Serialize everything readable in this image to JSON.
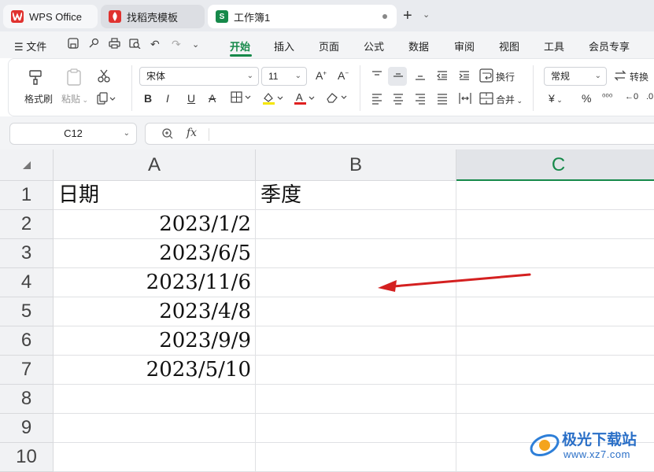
{
  "tabs": {
    "wps": "WPS Office",
    "template": "找稻壳模板",
    "workbook": "工作簿1",
    "workbook_icon": "S"
  },
  "menu": {
    "file": "文件",
    "items": [
      "开始",
      "插入",
      "页面",
      "公式",
      "数据",
      "审阅",
      "视图",
      "工具",
      "会员专享"
    ]
  },
  "ribbon": {
    "format_painter": "格式刷",
    "paste": "粘贴",
    "font_name": "宋体",
    "font_size": "11",
    "wrap": "换行",
    "merge": "合并",
    "number_format": "常规",
    "convert": "转换",
    "currency": "¥",
    "percent": "%"
  },
  "formula_bar": {
    "cell_ref": "C12",
    "fx": "fx"
  },
  "sheet": {
    "columns": [
      "A",
      "B",
      "C"
    ],
    "rows": [
      "1",
      "2",
      "3",
      "4",
      "5",
      "6",
      "7",
      "8",
      "9",
      "10"
    ],
    "cells": {
      "A1": "日期",
      "B1": "季度",
      "A2": "2023/1/2",
      "A3": "2023/6/5",
      "A4": "2023/11/6",
      "A5": "2023/4/8",
      "A6": "2023/9/9",
      "A7": "2023/5/10"
    }
  },
  "watermark": {
    "name": "极光下载站",
    "url": "www.xz7.com"
  },
  "colors": {
    "accent": "#16894a",
    "arrow": "#d42020"
  }
}
